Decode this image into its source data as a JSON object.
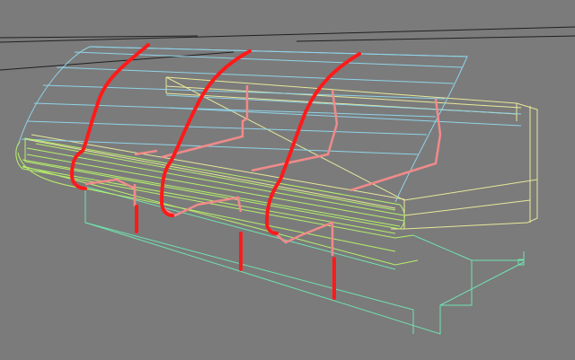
{
  "viewport": {
    "background": "#7b7b7b",
    "grid_color": "#1f1f1f"
  },
  "colors": {
    "glass_wire": "#8fd3e8",
    "frame_wire": "#e8e89a",
    "base_wire": "#6fe3b0",
    "shelf_wire": "#b6f06a",
    "highlight_red": "#ff1a1a",
    "section_pink": "#f08a8a"
  },
  "scene_objects": [
    {
      "name": "display-case-glass",
      "kind": "wireframe"
    },
    {
      "name": "display-case-frame",
      "kind": "wireframe"
    },
    {
      "name": "display-case-base",
      "kind": "wireframe"
    },
    {
      "name": "front-shelf-rail",
      "kind": "wireframe"
    },
    {
      "name": "cross-section-curves",
      "kind": "highlight",
      "count": 3
    }
  ]
}
